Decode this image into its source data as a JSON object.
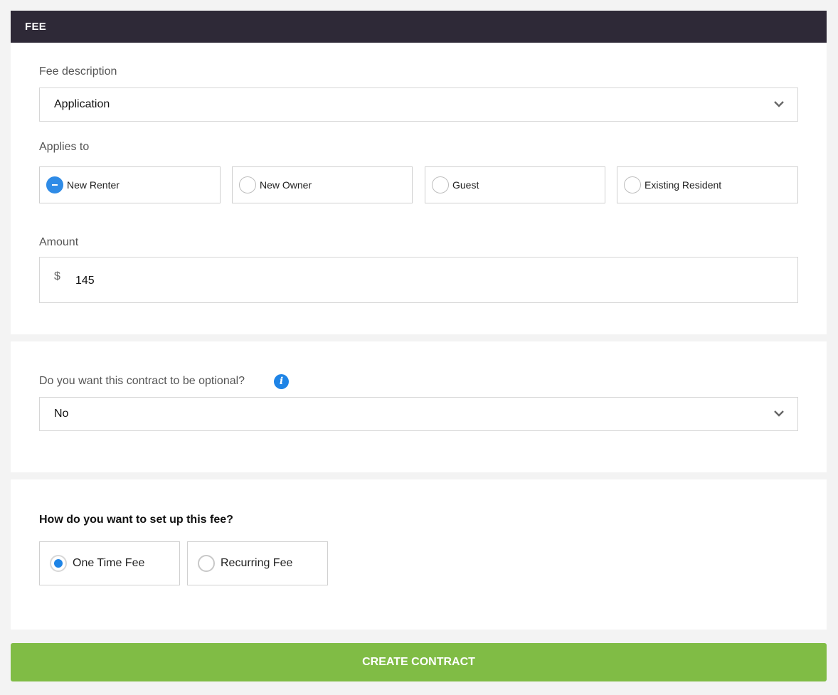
{
  "header": {
    "title": "FEE"
  },
  "fee_description": {
    "label": "Fee description",
    "value": "Application"
  },
  "applies_to": {
    "label": "Applies to",
    "options": [
      {
        "label": "New Renter",
        "state": "indeterminate"
      },
      {
        "label": "New Owner",
        "state": "unchecked"
      },
      {
        "label": "Guest",
        "state": "unchecked"
      },
      {
        "label": "Existing Resident",
        "state": "unchecked"
      }
    ]
  },
  "amount": {
    "label": "Amount",
    "currency_symbol": "$",
    "value": "145"
  },
  "optional": {
    "label": "Do you want this contract to be optional?",
    "info_icon": "info-icon",
    "value": "No"
  },
  "fee_setup": {
    "label": "How do you want to set up this fee?",
    "options": [
      {
        "label": "One Time Fee",
        "selected": true
      },
      {
        "label": "Recurring Fee",
        "selected": false
      }
    ]
  },
  "actions": {
    "create_label": "CREATE CONTRACT"
  },
  "colors": {
    "header_bg": "#2e2937",
    "accent_blue": "#1e84e6",
    "button_green": "#80bc45"
  }
}
